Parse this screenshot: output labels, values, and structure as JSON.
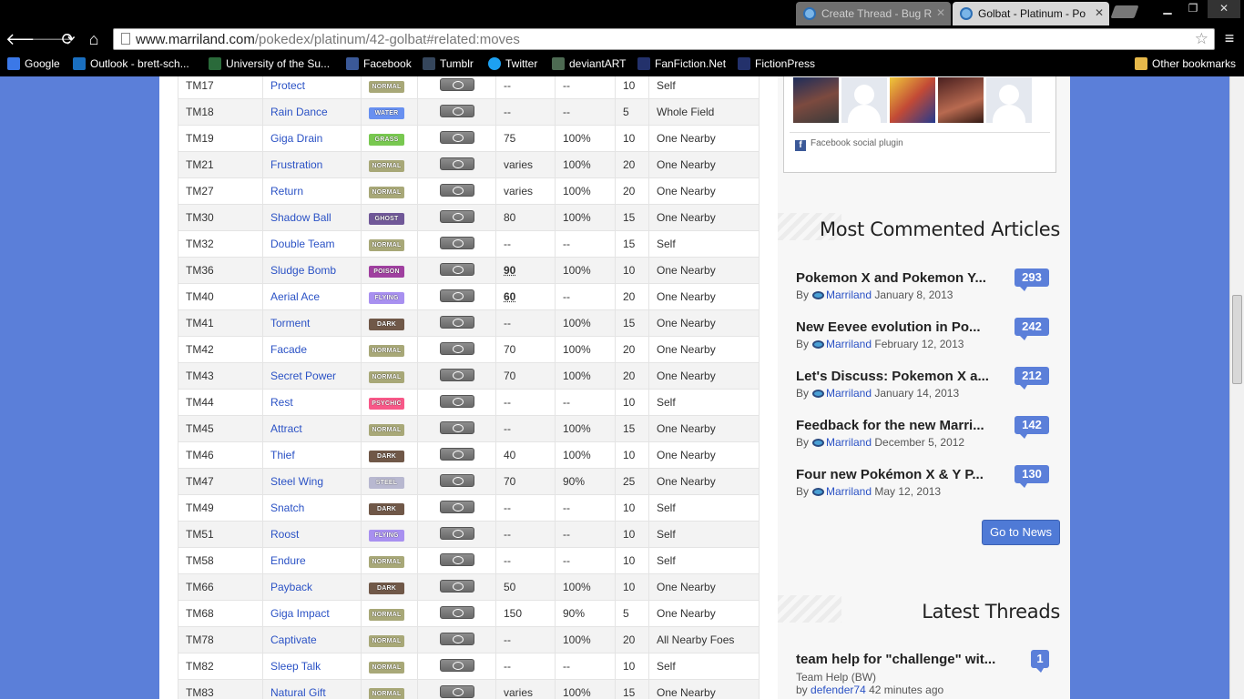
{
  "browser": {
    "tabs": [
      {
        "title": "Create Thread - Bug R",
        "active": false
      },
      {
        "title": "Golbat - Platinum - Po",
        "active": true
      }
    ],
    "url_host": "www.marriland.com",
    "url_path": "/pokedex/platinum/42-golbat#related:moves",
    "bookmarks": [
      "Google",
      "Outlook - brett-sch...",
      "University of the Su...",
      "Facebook",
      "Tumblr",
      "Twitter",
      "deviantART",
      "FanFiction.Net",
      "FictionPress"
    ],
    "other_bookmarks": "Other bookmarks"
  },
  "type_colors": {
    "NORMAL": "#a8a878",
    "WATER": "#6890f0",
    "GRASS": "#78c850",
    "GHOST": "#705898",
    "POISON": "#a040a0",
    "FLYING": "#a890f0",
    "DARK": "#705848",
    "PSYCHIC": "#f85888",
    "STEEL": "#b8b8d0"
  },
  "moves": [
    {
      "tm": "TM17",
      "name": "Protect",
      "type": "NORMAL",
      "power": "--",
      "accuracy": "--",
      "pp": "10",
      "target": "Self",
      "bold": false
    },
    {
      "tm": "TM18",
      "name": "Rain Dance",
      "type": "WATER",
      "power": "--",
      "accuracy": "--",
      "pp": "5",
      "target": "Whole Field",
      "bold": false
    },
    {
      "tm": "TM19",
      "name": "Giga Drain",
      "type": "GRASS",
      "power": "75",
      "accuracy": "100%",
      "pp": "10",
      "target": "One Nearby",
      "bold": false
    },
    {
      "tm": "TM21",
      "name": "Frustration",
      "type": "NORMAL",
      "power": "varies",
      "accuracy": "100%",
      "pp": "20",
      "target": "One Nearby",
      "bold": false
    },
    {
      "tm": "TM27",
      "name": "Return",
      "type": "NORMAL",
      "power": "varies",
      "accuracy": "100%",
      "pp": "20",
      "target": "One Nearby",
      "bold": false
    },
    {
      "tm": "TM30",
      "name": "Shadow Ball",
      "type": "GHOST",
      "power": "80",
      "accuracy": "100%",
      "pp": "15",
      "target": "One Nearby",
      "bold": false
    },
    {
      "tm": "TM32",
      "name": "Double Team",
      "type": "NORMAL",
      "power": "--",
      "accuracy": "--",
      "pp": "15",
      "target": "Self",
      "bold": false
    },
    {
      "tm": "TM36",
      "name": "Sludge Bomb",
      "type": "POISON",
      "power": "90",
      "accuracy": "100%",
      "pp": "10",
      "target": "One Nearby",
      "bold": true
    },
    {
      "tm": "TM40",
      "name": "Aerial Ace",
      "type": "FLYING",
      "power": "60",
      "accuracy": "--",
      "pp": "20",
      "target": "One Nearby",
      "bold": true
    },
    {
      "tm": "TM41",
      "name": "Torment",
      "type": "DARK",
      "power": "--",
      "accuracy": "100%",
      "pp": "15",
      "target": "One Nearby",
      "bold": false
    },
    {
      "tm": "TM42",
      "name": "Facade",
      "type": "NORMAL",
      "power": "70",
      "accuracy": "100%",
      "pp": "20",
      "target": "One Nearby",
      "bold": false
    },
    {
      "tm": "TM43",
      "name": "Secret Power",
      "type": "NORMAL",
      "power": "70",
      "accuracy": "100%",
      "pp": "20",
      "target": "One Nearby",
      "bold": false
    },
    {
      "tm": "TM44",
      "name": "Rest",
      "type": "PSYCHIC",
      "power": "--",
      "accuracy": "--",
      "pp": "10",
      "target": "Self",
      "bold": false
    },
    {
      "tm": "TM45",
      "name": "Attract",
      "type": "NORMAL",
      "power": "--",
      "accuracy": "100%",
      "pp": "15",
      "target": "One Nearby",
      "bold": false
    },
    {
      "tm": "TM46",
      "name": "Thief",
      "type": "DARK",
      "power": "40",
      "accuracy": "100%",
      "pp": "10",
      "target": "One Nearby",
      "bold": false
    },
    {
      "tm": "TM47",
      "name": "Steel Wing",
      "type": "STEEL",
      "power": "70",
      "accuracy": "90%",
      "pp": "25",
      "target": "One Nearby",
      "bold": false
    },
    {
      "tm": "TM49",
      "name": "Snatch",
      "type": "DARK",
      "power": "--",
      "accuracy": "--",
      "pp": "10",
      "target": "Self",
      "bold": false
    },
    {
      "tm": "TM51",
      "name": "Roost",
      "type": "FLYING",
      "power": "--",
      "accuracy": "--",
      "pp": "10",
      "target": "Self",
      "bold": false
    },
    {
      "tm": "TM58",
      "name": "Endure",
      "type": "NORMAL",
      "power": "--",
      "accuracy": "--",
      "pp": "10",
      "target": "Self",
      "bold": false
    },
    {
      "tm": "TM66",
      "name": "Payback",
      "type": "DARK",
      "power": "50",
      "accuracy": "100%",
      "pp": "10",
      "target": "One Nearby",
      "bold": false
    },
    {
      "tm": "TM68",
      "name": "Giga Impact",
      "type": "NORMAL",
      "power": "150",
      "accuracy": "90%",
      "pp": "5",
      "target": "One Nearby",
      "bold": false
    },
    {
      "tm": "TM78",
      "name": "Captivate",
      "type": "NORMAL",
      "power": "--",
      "accuracy": "100%",
      "pp": "20",
      "target": "All Nearby Foes",
      "bold": false
    },
    {
      "tm": "TM82",
      "name": "Sleep Talk",
      "type": "NORMAL",
      "power": "--",
      "accuracy": "--",
      "pp": "10",
      "target": "Self",
      "bold": false
    },
    {
      "tm": "TM83",
      "name": "Natural Gift",
      "type": "NORMAL",
      "power": "varies",
      "accuracy": "100%",
      "pp": "15",
      "target": "One Nearby",
      "bold": false
    }
  ],
  "sidebar": {
    "fb_plugin_label": "Facebook social plugin",
    "articles_title": "Most Commented Articles",
    "articles": [
      {
        "title": "Pokemon X and Pokemon Y...",
        "author": "Marriland",
        "date": "January 8, 2013",
        "count": "293"
      },
      {
        "title": "New Eevee evolution in Po...",
        "author": "Marriland",
        "date": "February 12, 2013",
        "count": "242"
      },
      {
        "title": "Let's Discuss: Pokemon X a...",
        "author": "Marriland",
        "date": "January 14, 2013",
        "count": "212"
      },
      {
        "title": "Feedback for the new Marri...",
        "author": "Marriland",
        "date": "December 5, 2012",
        "count": "142"
      },
      {
        "title": "Four new Pokémon X & Y P...",
        "author": "Marriland",
        "date": "May 12, 2013",
        "count": "130"
      }
    ],
    "by_label": "By",
    "go_news_label": "Go to News",
    "threads_title": "Latest Threads",
    "thread": {
      "title": "team help for \"challenge\" wit...",
      "forum": "Team Help (BW)",
      "by": "by",
      "author": "defender74",
      "time": "42 minutes ago",
      "count": "1"
    }
  }
}
